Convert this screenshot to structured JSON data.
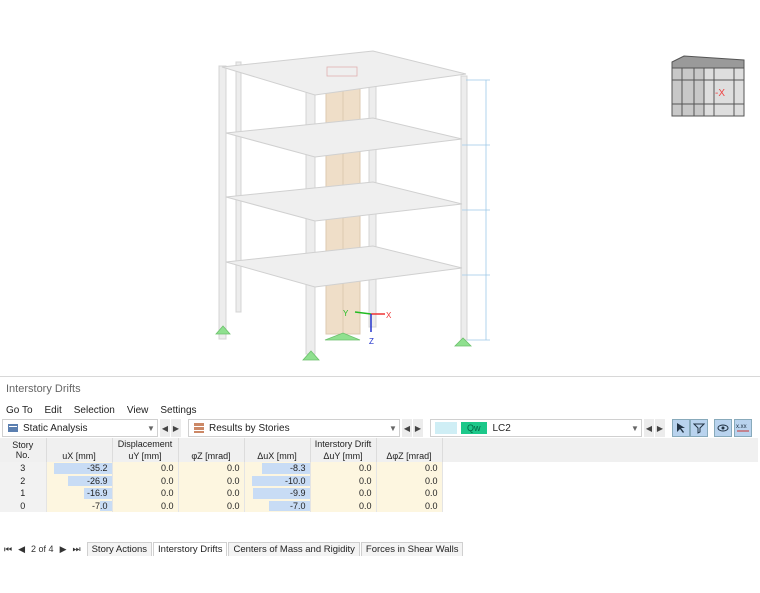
{
  "viewport": {
    "axis_labels": {
      "x": "X",
      "y": "Y",
      "z": "Z"
    },
    "viewcube_label": "-X",
    "colors": {
      "slab": "#efefef",
      "wall": "#efdec8",
      "support": "#8fe08f",
      "dim": "#9ec9e8"
    }
  },
  "panel": {
    "title": "Interstory Drifts",
    "menu": [
      "Go To",
      "Edit",
      "Selection",
      "View",
      "Settings"
    ],
    "toolbar": {
      "analysis": "Static Analysis",
      "results": "Results by Stories",
      "lc_badge": "Qw",
      "lc_name": "LC2"
    },
    "table": {
      "group_headers": {
        "displacement": "Displacement",
        "drift": "Interstory Drift"
      },
      "story_header": [
        "Story",
        "No."
      ],
      "columns": [
        "uX [mm]",
        "uY [mm]",
        "φZ [mrad]",
        "ΔuX [mm]",
        "ΔuY [mm]",
        "ΔφZ [mrad]"
      ],
      "rows": [
        {
          "story": "3",
          "ux": "-35.2",
          "uy": "0.0",
          "phiz": "0.0",
          "dux": "-8.3",
          "duy": "0.0",
          "dphiz": "0.0",
          "ux_frac": 1.0,
          "dux_frac": 0.83
        },
        {
          "story": "2",
          "ux": "-26.9",
          "uy": "0.0",
          "phiz": "0.0",
          "dux": "-10.0",
          "duy": "0.0",
          "dphiz": "0.0",
          "ux_frac": 0.76,
          "dux_frac": 1.0
        },
        {
          "story": "1",
          "ux": "-16.9",
          "uy": "0.0",
          "phiz": "0.0",
          "dux": "-9.9",
          "duy": "0.0",
          "dphiz": "0.0",
          "ux_frac": 0.48,
          "dux_frac": 0.99
        },
        {
          "story": "0",
          "ux": "-7.0",
          "uy": "0.0",
          "phiz": "0.0",
          "dux": "-7.0",
          "duy": "0.0",
          "dphiz": "0.0",
          "ux_frac": 0.2,
          "dux_frac": 0.7
        }
      ]
    },
    "pager": "2 of 4",
    "tabs": [
      "Story Actions",
      "Interstory Drifts",
      "Centers of Mass and Rigidity",
      "Forces in Shear Walls"
    ],
    "active_tab": 1
  }
}
